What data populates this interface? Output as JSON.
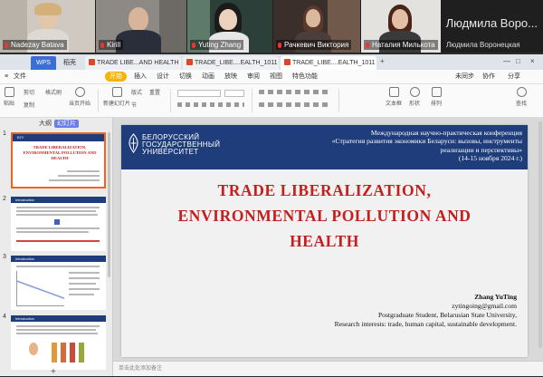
{
  "participants": [
    {
      "name": "Nadezay Batava",
      "muted": true
    },
    {
      "name": "Kirill",
      "muted": true
    },
    {
      "name": "Yuting Zhang",
      "muted": true,
      "active": true
    },
    {
      "name": "Рачкевич Виктория",
      "muted": true
    },
    {
      "name": "Наталия Милькота",
      "muted": true
    },
    {
      "name": "Людмила Воронецкая",
      "muted": false
    }
  ],
  "speaker_banner": "Людмила Воро...",
  "app": {
    "home_tab": "WPS",
    "tabs": [
      "稻壳",
      "TRADE LIBE...AND HEALTH",
      "TRADE_LIBE....EALTH_1011",
      "TRADE_LIBE....EALTH_1011"
    ],
    "menus": [
      "文件",
      "开始",
      "插入",
      "设计",
      "切换",
      "动画",
      "放映",
      "审阅",
      "视图",
      "特色功能"
    ],
    "active_menu": "开始",
    "right_menu": [
      "未同步",
      "协作",
      "分享"
    ],
    "toolbar": [
      "粘贴",
      "剪切",
      "复制",
      "格式刷",
      "当页开始",
      "新建幻灯片",
      "版式",
      "节",
      "重置",
      "文本框",
      "形状",
      "排列",
      "查找"
    ]
  },
  "panel": {
    "tabs": [
      "大纲",
      "幻灯片"
    ],
    "active_tab": "幻灯片",
    "thumbs": [
      {
        "num": "1",
        "title": "TRADE LIBERALIZATION, ENVIRONMENTAL POLLUTION AND HEALTH"
      },
      {
        "num": "2",
        "title": "Introduction"
      },
      {
        "num": "3",
        "title": "Introduction"
      },
      {
        "num": "4",
        "title": "Introduction"
      }
    ]
  },
  "slide": {
    "university": [
      "БЕЛОРУССКИЙ",
      "ГОСУДАРСТВЕННЫЙ",
      "УНИВЕРСИТЕТ"
    ],
    "conference_lines": [
      "Международная научно-практическая конференция",
      "«Стратегия развития экономики Беларуси: вызовы, инструменты",
      "реализации и перспективы»",
      "(14-15 ноября 2024 г.)"
    ],
    "title_lines": [
      "TRADE LIBERALIZATION,",
      "ENVIRONMENTAL POLLUTION AND",
      "HEALTH"
    ],
    "author": "Zhang YuTing",
    "email": "zytingoing@gmail.com",
    "affiliation": "Postgraduate Student, Belarusian State University,",
    "interests": "Research interests: trade, human capital, sustainable development."
  },
  "notes_placeholder": "单击此处添加备注",
  "colors": {
    "slide_header": "#1e3d7a",
    "title_red": "#c41e1e",
    "selection": "#f0641e",
    "wps_blue": "#3b6fd6"
  }
}
